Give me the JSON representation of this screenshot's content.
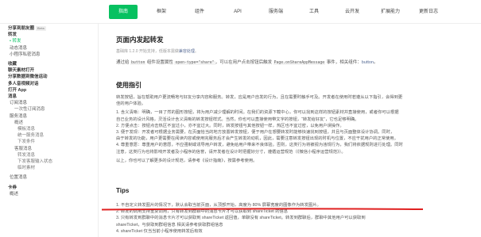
{
  "nav": {
    "items": [
      {
        "label": "指南",
        "active": true
      },
      {
        "label": "框架"
      },
      {
        "label": "组件"
      },
      {
        "label": "API"
      },
      {
        "label": "服务端"
      },
      {
        "label": "工具"
      },
      {
        "label": "云开发"
      },
      {
        "label": "扩展能力"
      },
      {
        "label": "更新日志"
      }
    ]
  },
  "sidebar": {
    "items": [
      {
        "label": "分享到朋友圈",
        "badge": "Beta",
        "level": 0
      },
      {
        "label": "转发",
        "level": 0
      },
      {
        "label": "• 转发",
        "level": 1,
        "active": true
      },
      {
        "label": "动态消息",
        "level": 1
      },
      {
        "label": "小程序私密消息",
        "level": 1
      },
      {
        "label": "",
        "level": 0
      },
      {
        "label": "收藏",
        "level": 0
      },
      {
        "label": "聊天素材打开",
        "level": 0
      },
      {
        "label": "分享数据到微信运动",
        "level": 0
      },
      {
        "label": "多人音视频对话",
        "level": 0
      },
      {
        "label": "打开 App",
        "level": 0
      },
      {
        "label": "消息",
        "level": 0
      },
      {
        "label": "订阅消息",
        "level": 1
      },
      {
        "label": "一次性订阅消息",
        "level": 2
      },
      {
        "label": "服务消息",
        "level": 1
      },
      {
        "label": "概述",
        "level": 2
      },
      {
        "label": "模板消息",
        "level": 3
      },
      {
        "label": "统一服务消息",
        "level": 3
      },
      {
        "label": "下发条件",
        "level": 3
      },
      {
        "label": "客服消息",
        "level": 2
      },
      {
        "label": "转发消息",
        "level": 3
      },
      {
        "label": "下发客服输入状态",
        "level": 3
      },
      {
        "label": "临时素材",
        "level": 3
      },
      {
        "label": "",
        "level": 0
      },
      {
        "label": "位置消息",
        "level": 1
      },
      {
        "label": "",
        "level": 0
      },
      {
        "label": "卡券",
        "level": 0
      },
      {
        "label": "概述",
        "level": 1
      }
    ]
  },
  "main": {
    "title": "页面内发起转发",
    "subtitle_prefix": "基础库 1.2.0 开始支持，低版本需做",
    "subtitle_link": "兼容处理",
    "subtitle_suffix": "。",
    "intro_prefix": "通过给",
    "intro_code1": "button",
    "intro_mid1": "组件设置属性",
    "intro_code2": "open-type=\"share\"",
    "intro_mid2": "，可以在用户点击按钮后触发",
    "intro_link1": "Page.onShareAppMessage",
    "intro_mid3": "事件，相关组件：",
    "intro_link2": "button",
    "intro_end": "。",
    "guide_title": "使用指引",
    "guide_lines": [
      "转发按钮，旨在帮助用户更流畅地与好友分享内容和服务。转发，应是用户自发的行为，且在需要时触手可及。开发者在使用时若遵从以下指引，会得到更",
      "佳的用户体验。",
      "1. 含义清晰：明确，一目了然的图形按钮，将为用户减少理解的时间。在我们的资源下载中心，你可以找到这样的按钮素材并直接使用，或者你可以根据",
      "    自己业务的设计风格，灵活设计含义清晰的转发按钮样式。当然，你也可以直接使用带文字的按钮，“转发给好友”，它也足够明确。",
      "2. 方便点击：按钮点击热区不宜过小，亦不宜过大。同时，转发按钮与其他按钮一样，热区也不宜过密，以免用户误操作。",
      "3. 便于发现：开发者可根据业务需要，在页面恰当的地方放置转发按钮，便于用户在想要转发时能够快速找到按钮，并且与页面整体设计协调。同时，",
      "    由于转发的功能，用户更需要在阅读内容或使用完服务后才会产生转发的动机，因此，需要注意转发按钮出现的时机与位置，不应干扰用户的正常使用。",
      "4. 尊重意愿：尊重用户的意愿，不应强制或诱导用户转发，避免给用户带来不良体验。否则，这类行为将被视为违规行为，我们将依据规则进行处理。同时",
      "    注意，这类行为也将影响开发者及小程序的信誉，请开发者在设计时把握好分寸，遵循运营规范（《微信小程序运营规范》）。",
      "以上，你也可以了解更多的设计规范，请参考《设计指南》，按需参考使用。"
    ],
    "tips_title": "Tips",
    "tips": [
      "1. 不自定义转发图片的情况下，默认会取当前页面，从顶部开始，高度为 80% 屏幕宽度的图像作为转发图片。",
      "2. 转发的调用支持重复调用，只有转发到群聊中的消息卡片才可以获取到 shareTicket 的信息",
      "3. 只有转发到群聊中的消息卡片才可以获取到 shareTicket 返回值，单聊没有 shareTicket。转发到群聊后，群聊中其他用户可以获取到",
      "   shareTicket，与获取到群组信息 相关请参考获取群组信息",
      "4. shareTicket 仅当当前小程序使用转发后有效"
    ]
  },
  "colors": {
    "accent": "#07c160",
    "link": "#576b95",
    "underline": "#e02020"
  }
}
